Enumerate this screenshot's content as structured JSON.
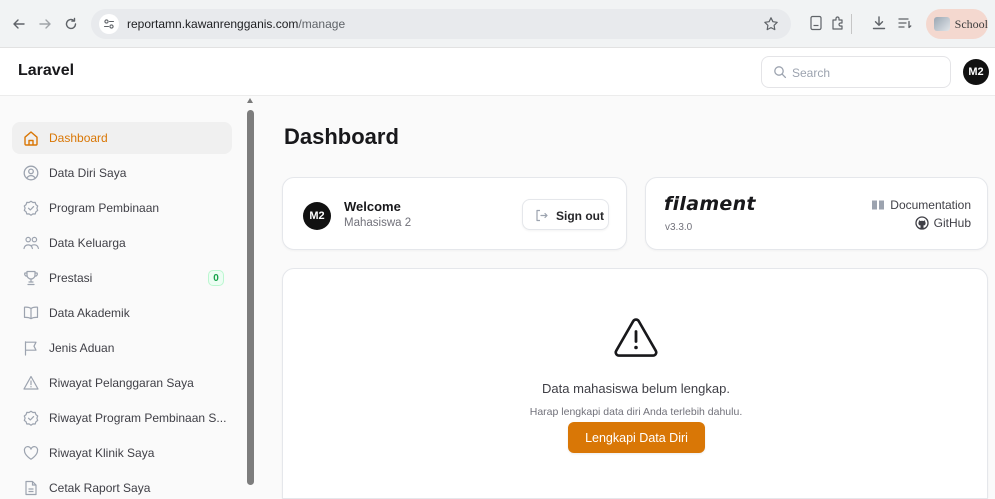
{
  "browser": {
    "url_host": "reportamn.kawanrengganis.com",
    "url_path": "/manage",
    "profile_label": "School"
  },
  "app": {
    "brand": "Laravel",
    "search_placeholder": "Search",
    "user_initials": "M2"
  },
  "sidebar": {
    "items": [
      {
        "label": "Dashboard",
        "icon": "home-icon",
        "active": true
      },
      {
        "label": "Data Diri Saya",
        "icon": "user-circle-icon"
      },
      {
        "label": "Program Pembinaan",
        "icon": "badge-check-icon"
      },
      {
        "label": "Data Keluarga",
        "icon": "users-icon"
      },
      {
        "label": "Prestasi",
        "icon": "trophy-icon",
        "badge": "0"
      },
      {
        "label": "Data Akademik",
        "icon": "book-open-icon"
      },
      {
        "label": "Jenis Aduan",
        "icon": "flag-icon"
      },
      {
        "label": "Riwayat Pelanggaran Saya",
        "icon": "warning-icon"
      },
      {
        "label": "Riwayat Program Pembinaan S...",
        "icon": "badge-check-icon"
      },
      {
        "label": "Riwayat Klinik Saya",
        "icon": "heart-icon"
      },
      {
        "label": "Cetak Raport Saya",
        "icon": "document-icon"
      }
    ]
  },
  "main": {
    "title": "Dashboard",
    "welcome": {
      "title": "Welcome",
      "name": "Mahasiswa 2",
      "initials": "M2",
      "sign_out_label": "Sign out"
    },
    "filament": {
      "logo": "filament",
      "version": "v3.3.0",
      "documentation_label": "Documentation",
      "github_label": "GitHub"
    },
    "notice": {
      "title": "Data mahasiswa belum lengkap.",
      "subtitle": "Harap lengkapi data diri Anda terlebih dahulu.",
      "button_label": "Lengkapi Data Diri"
    }
  },
  "colors": {
    "accent": "#d97706",
    "badge_success": "#16a34a"
  }
}
